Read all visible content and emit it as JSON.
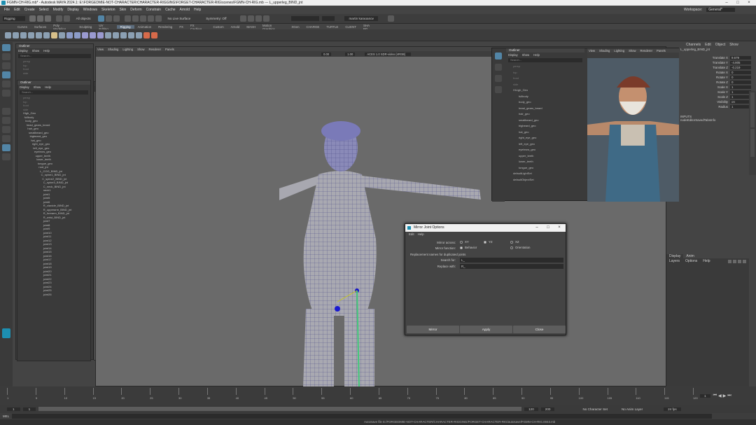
{
  "window": {
    "title": "FGMN-CH-RIG.mb* - Autodesk MAYA 2024.1: E:\\FORGEDMIE-NOT-CHARACTER\\CHARACTER-RIGGING\\FORGET-CHARACTER-RIG\\scenes\\FGMN-CH-RIG.mb    ---    L_upperleg_BIND_jnt"
  },
  "menubar": [
    "File",
    "Edit",
    "Create",
    "Select",
    "Modify",
    "Display",
    "Windows",
    "Skeleton",
    "Skin",
    "Deform",
    "Constrain",
    "Cache",
    "Arnold",
    "Help"
  ],
  "status_line": {
    "mode": "Rigging",
    "objects": "All objects",
    "live_surface": "No Live Surface",
    "symmetry": "Symmetry: Off",
    "user": "martin karaoanov",
    "workspace_label": "Workspace:",
    "workspace": "General*"
  },
  "shelf_tabs": [
    "Curves",
    "Surfaces",
    "Poly Modeling",
    "Sculpting",
    "UV Editing",
    "Rigging",
    "Animation",
    "Rendering",
    "FX",
    "FX Caching",
    "Custom",
    "Arnold",
    "MASH",
    "Motion Graphics",
    "XGen",
    "CHARGE",
    "TURTLE",
    "CLIENT",
    "SHA BG"
  ],
  "shelf_active": "Rigging",
  "outliner_left": {
    "title": "Outliner",
    "menu": [
      "Display",
      "Show",
      "Help"
    ],
    "search": "Search...",
    "items": [
      "persp",
      "top",
      "front",
      "side"
    ]
  },
  "outliner_mid": {
    "title": "Outliner",
    "menu": [
      "Display",
      "Show",
      "Help"
    ],
    "search": "Search...",
    "items": [
      "persp",
      "top",
      "front",
      "side",
      "High_Geo",
      "fullbody",
      "body_geo",
      "head_gears_beard",
      "hair_geo",
      "smallbeard_geo",
      "bigbeard_geo",
      "hat_geo",
      "right_eye_geo",
      "left_eye_geo",
      "eyebrow_geo",
      "upper_teeth",
      "lower_teeth",
      "tongue_geo",
      "root_jnt",
      "L_COG_BIND_jnt",
      "C_spine1_BIND_jnt",
      "C_spine2_BIND_jnt",
      "C_spine3_BIND_jnt",
      "C_neck_BIND_jnt",
      "neck1",
      "joint1",
      "joint5",
      "joint6",
      "R_clavicle_BIND_jnt",
      "R_upperarm_BIND_jnt",
      "R_forearm_BIND_jnt",
      "R_wrist_BIND_jnt",
      "joint7",
      "joint8",
      "joint9",
      "joint10",
      "joint11",
      "joint12",
      "joint13",
      "joint14",
      "joint15",
      "joint16",
      "joint17",
      "joint18",
      "joint19",
      "joint20",
      "joint21",
      "joint22",
      "joint23",
      "joint24",
      "joint25",
      "joint26"
    ]
  },
  "outliner_right": {
    "title": "Outliner",
    "menu": [
      "Display",
      "Show",
      "Help"
    ],
    "search": "Search...",
    "items": [
      "persp",
      "top",
      "front",
      "side",
      "HiLigh_Geo",
      "fullbody",
      "body_geo",
      "head_gears_beard",
      "hair_geo",
      "smallbeard_geo",
      "bigbeard_geo",
      "hat_geo",
      "right_eye_geo",
      "left_eye_geo",
      "eyebrow_geo",
      "upper_teeth",
      "lower_teeth",
      "tongue_geo",
      "defaultLightSet",
      "defaultObjectSet"
    ]
  },
  "viewport_menu": [
    "View",
    "Shading",
    "Lighting",
    "Show",
    "Renderer",
    "Panels"
  ],
  "main_viewport": {
    "exposure": "0.00",
    "gamma": "1.00",
    "colorspace": "ACES 1.0 SDR-video (sRGB)"
  },
  "channel_box": {
    "menu": [
      "Channels",
      "Edit",
      "Object",
      "Show"
    ],
    "object": "L_upperleg_BIND_jnt",
    "channels": [
      {
        "name": "Translate X",
        "value": "9.679"
      },
      {
        "name": "Translate Y",
        "value": "-4.805"
      },
      {
        "name": "Translate Z",
        "value": "-0.219"
      },
      {
        "name": "Rotate X",
        "value": "0"
      },
      {
        "name": "Rotate Y",
        "value": "0"
      },
      {
        "name": "Rotate Z",
        "value": "0"
      },
      {
        "name": "Scale X",
        "value": "1"
      },
      {
        "name": "Scale Y",
        "value": "1"
      },
      {
        "name": "Scale Z",
        "value": "1"
      },
      {
        "name": "Visibility",
        "value": "on"
      },
      {
        "name": "Radius",
        "value": "1"
      }
    ],
    "inputs_label": "INPUTS",
    "input_item": "nodeEditorSavedTabsInfo"
  },
  "layer_editor": {
    "tabs": [
      "Display",
      "Anim"
    ],
    "menu": [
      "Layers",
      "Options",
      "Help"
    ]
  },
  "dialog": {
    "title": "Mirror Joint Options",
    "menu": [
      "Edit",
      "Help"
    ],
    "mirror_across_label": "Mirror across:",
    "mirror_across_options": [
      "XY",
      "YZ",
      "XZ"
    ],
    "mirror_across_selected": "YZ",
    "mirror_function_label": "Mirror function:",
    "mirror_function_options": [
      "Behavior",
      "Orientation"
    ],
    "mirror_function_selected": "Behavior",
    "replacement_label": "Replacement names for duplicated joints",
    "search_label": "Search for:",
    "search_value": "L_",
    "replace_label": "Replace with:",
    "replace_value": "R_",
    "buttons": {
      "mirror": "Mirror",
      "apply": "Apply",
      "close": "Close"
    }
  },
  "timeline": {
    "ticks": [
      "1",
      "5",
      "10",
      "15",
      "20",
      "25",
      "30",
      "35",
      "40",
      "45",
      "50",
      "55",
      "60",
      "65",
      "70",
      "75",
      "80",
      "85",
      "90",
      "95",
      "100",
      "105",
      "110",
      "115",
      "120"
    ],
    "current_frame": "1",
    "range_start": "1",
    "range_inner_start": "1",
    "range_inner_end": "120",
    "range_end": "120",
    "range_max": "200",
    "character_set": "No Character Set",
    "anim_layer": "No Anim Layer",
    "fps": "24 fps"
  },
  "command_line": {
    "lang": "MEL"
  },
  "help_line": "AutoSave file E:/FORGEDMIE-NOT-CHARACTER/CHARACTER-RIGGING/FORGET-CHARACTER-RIG/autosave/FGMN-CH-RIG.0043.mb"
}
